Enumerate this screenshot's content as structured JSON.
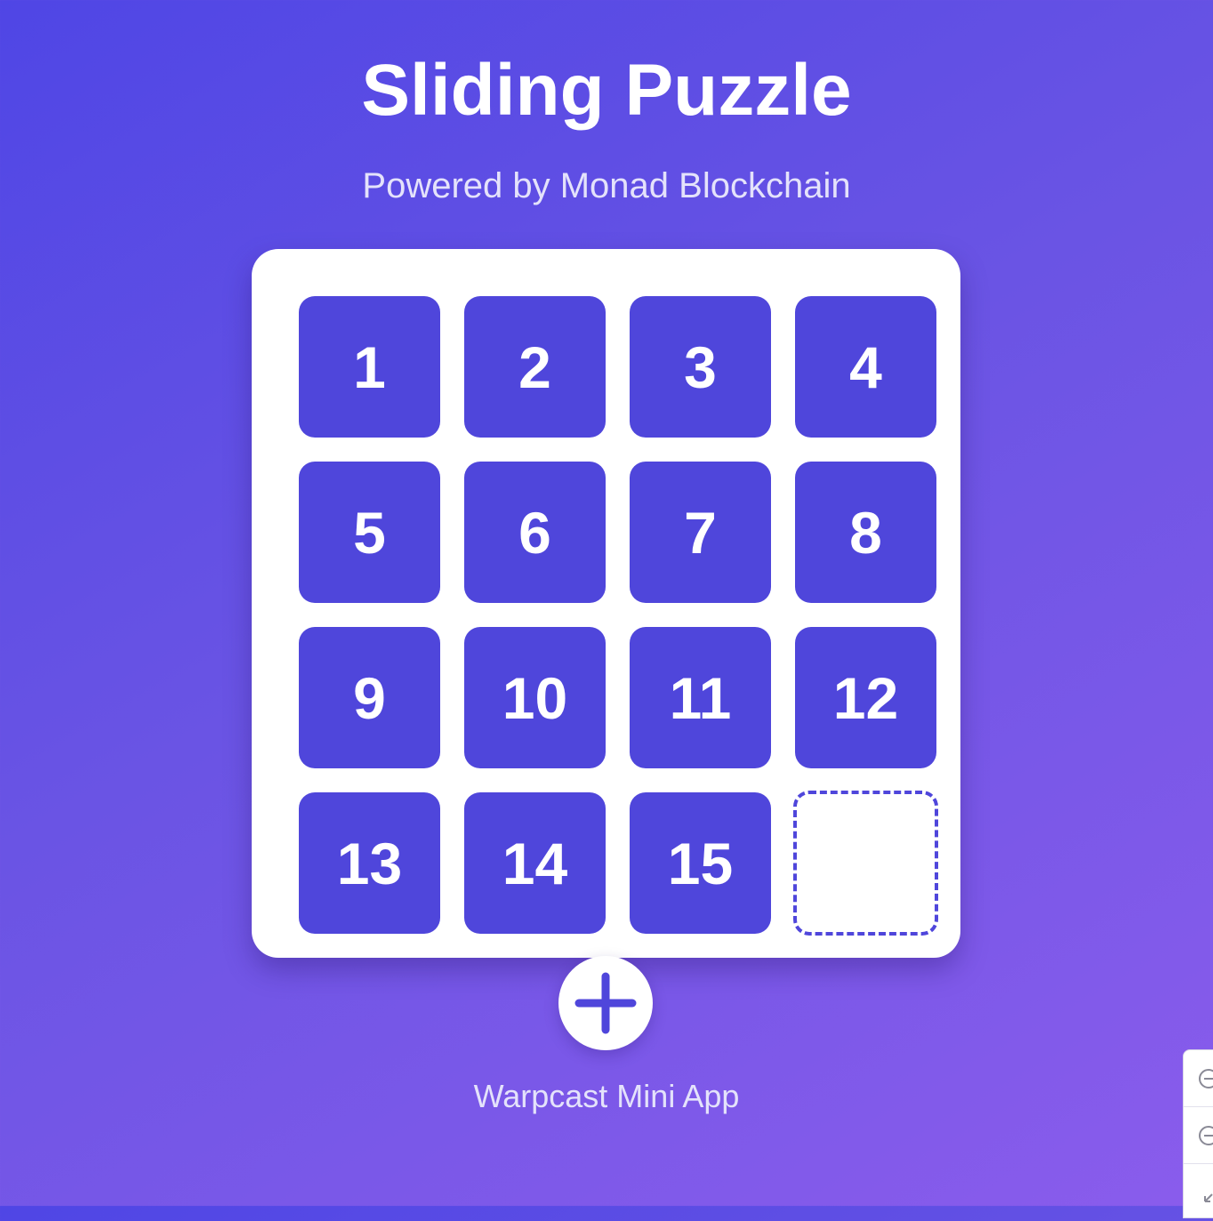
{
  "header": {
    "title": "Sliding Puzzle",
    "subtitle": "Powered by Monad Blockchain"
  },
  "board": {
    "grid_size": 4,
    "tiles": [
      "1",
      "2",
      "3",
      "4",
      "5",
      "6",
      "7",
      "8",
      "9",
      "10",
      "11",
      "12",
      "13",
      "14",
      "15",
      ""
    ],
    "empty_index": 15
  },
  "actions": {
    "add_icon": "plus-icon"
  },
  "footer": {
    "text": "Warpcast Mini App"
  },
  "side_widget": {
    "icons": [
      "zoom-in-icon",
      "zoom-out-icon",
      "collapse-icon"
    ]
  },
  "colors": {
    "tile": "#4f46db",
    "board": "#ffffff",
    "background_start": "#4f46e5",
    "background_end": "#8a5cec"
  }
}
